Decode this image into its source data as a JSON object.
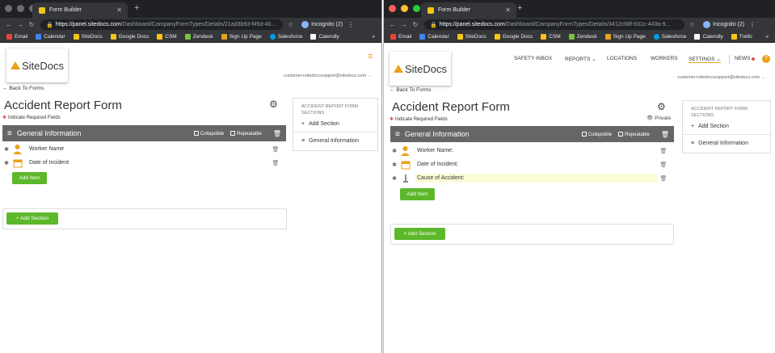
{
  "windows": [
    {
      "tab_title": "Form Builder",
      "url_host": "https://panel.sitedocs.com",
      "url_path": "/Dashboard/CompanyFormTypes/Details/21ad3b93-f45d-40...",
      "incognito": "Incognito (2)",
      "bookmarks": [
        "Email",
        "Calendar",
        "SiteDocs",
        "Google Docs",
        "CSM",
        "Zendesk",
        "Sign Up Page",
        "Salesforce",
        "Calendly"
      ],
      "logo_text": "SiteDocs",
      "account": "customer+sitedocssupport@sitedocs.com",
      "back_link": "Back To Forms",
      "form_title": "Accident Report Form",
      "required_note": "Indicate Required Fields",
      "section_title": "General Information",
      "collapsible": "Collapsible",
      "repeatable": "Repeatable",
      "items": [
        "Worker Name",
        "Date of Incident"
      ],
      "add_item": "Add Item",
      "add_section": "+ Add Section",
      "panel": {
        "title": "ACCIDENT REPORT FORM SECTIONS",
        "add_section": "Add Section",
        "section": "General Information"
      }
    },
    {
      "tab_title": "Form Builder",
      "url_host": "https://panel.sitedocs.com",
      "url_path": "/Dashboard/CompanyFormTypes/Details/3412c68f-931c-443a-9...",
      "incognito": "Incognito (2)",
      "bookmarks": [
        "Email",
        "Calendar",
        "SiteDocs",
        "Google Docs",
        "CSM",
        "Zendesk",
        "Sign Up Page",
        "Salesforce",
        "Calendly",
        "Trello"
      ],
      "logo_text": "SiteDocs",
      "nav": [
        "SAFETY INBOX",
        "REPORTS",
        "LOCATIONS",
        "WORKERS",
        "SETTINGS",
        "NEWS"
      ],
      "account": "customer+sitedocssupport@sitedocs.com",
      "back_link": "Back To Forms",
      "form_title": "Accident Report Form",
      "required_note": "Indicate Required Fields",
      "private": "Private",
      "section_title": "General Information",
      "collapsible": "Collapsible",
      "repeatable": "Repeatable",
      "items": [
        "Worker Name:",
        "Date of Incident:",
        "Cause of Accident:"
      ],
      "add_item": "Add Item",
      "add_section": "+ Add Section",
      "panel": {
        "title": "ACCIDENT REPORT FORM SECTIONS",
        "add_section": "Add Section",
        "section": "General Information"
      }
    }
  ],
  "colors": {
    "accent": "#e8a21b",
    "green": "#5cb82a",
    "section_header": "#666666",
    "required": "#d9534f"
  }
}
